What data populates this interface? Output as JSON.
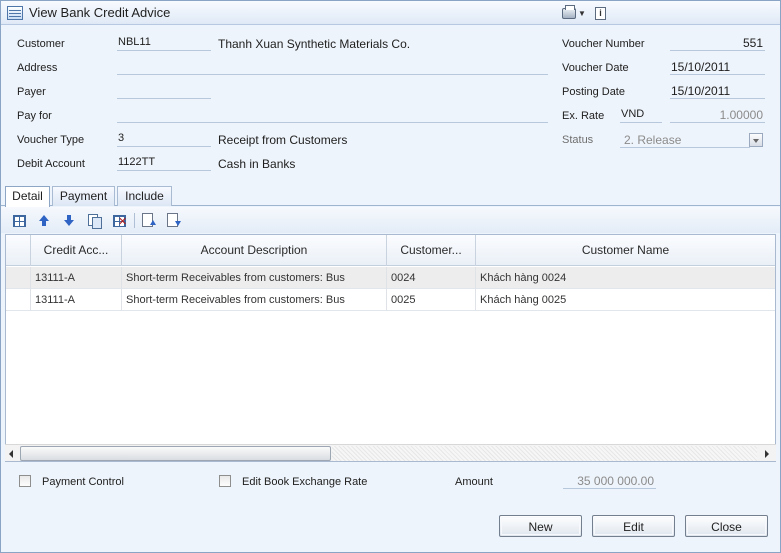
{
  "window": {
    "title": "View Bank Credit Advice"
  },
  "form": {
    "customer_label": "Customer",
    "customer_code": "NBL11",
    "customer_name": "Thanh Xuan Synthetic Materials Co.",
    "address_label": "Address",
    "address_value": "",
    "payer_label": "Payer",
    "payer_value": "",
    "pay_for_label": "Pay for",
    "pay_for_value": "",
    "voucher_type_label": "Voucher Type",
    "voucher_type_code": "3",
    "voucher_type_name": "Receipt from Customers",
    "debit_account_label": "Debit Account",
    "debit_account_code": "1122TT",
    "debit_account_name": "Cash in Banks",
    "voucher_number_label": "Voucher Number",
    "voucher_number": "551",
    "voucher_date_label": "Voucher Date",
    "voucher_date": "15/10/2011",
    "posting_date_label": "Posting Date",
    "posting_date": "15/10/2011",
    "ex_rate_label": "Ex. Rate",
    "currency": "VND",
    "ex_rate": "1.00000",
    "status_label": "Status",
    "status_value": "2. Release"
  },
  "tabs": [
    {
      "label": "Detail",
      "active": true
    },
    {
      "label": "Payment",
      "active": false
    },
    {
      "label": "Include",
      "active": false
    }
  ],
  "toolbar": {
    "icons": [
      "insert-row-icon",
      "move-up-icon",
      "move-down-icon",
      "copy-row-icon",
      "delete-row-icon",
      "page-up-icon",
      "page-down-icon"
    ]
  },
  "grid": {
    "columns": [
      "Credit Acc...",
      "Account Description",
      "Customer...",
      "Customer Name"
    ],
    "rows": [
      [
        "13111-A",
        "Short-term Receivables from customers: Bus",
        "0024",
        "Khách hàng 0024"
      ],
      [
        "13111-A",
        "Short-term Receivables from customers: Bus",
        "0025",
        "Khách hàng 0025"
      ]
    ]
  },
  "bottom": {
    "payment_control_label": "Payment Control",
    "edit_book_exchange_rate_label": "Edit Book Exchange Rate",
    "amount_label": "Amount",
    "amount_value": "35 000 000.00"
  },
  "buttons": {
    "new": "New",
    "edit": "Edit",
    "close": "Close"
  },
  "colors": {
    "window_bg": "#eef4fb",
    "border": "#8aa4c6",
    "alt_row": "#ededed",
    "field_line": "#b8c8dc"
  }
}
